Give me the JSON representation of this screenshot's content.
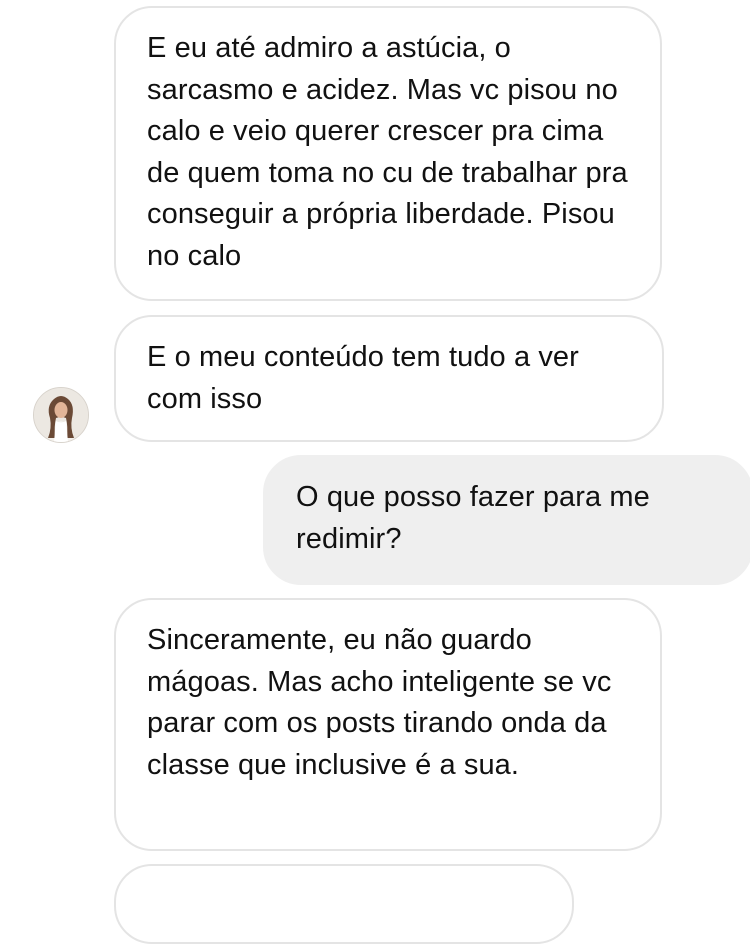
{
  "thread": {
    "messages": [
      {
        "sender": "other",
        "text": "E eu até admiro a astúcia, o sarcasmo e acidez. Mas vc pisou no calo e veio querer crescer pra cima de quem toma no cu de trabalhar pra conseguir a própria liberdade. Pisou no calo"
      },
      {
        "sender": "other",
        "text": "E o meu conteúdo tem tudo a ver com isso"
      },
      {
        "sender": "me",
        "text": "O que posso fazer para me redimir?"
      },
      {
        "sender": "other",
        "text": "Sinceramente, eu não guardo mágoas. Mas acho inteligente se vc parar com os posts tirando onda da classe que inclusive é a sua."
      },
      {
        "sender": "other",
        "text": ""
      }
    ]
  },
  "colors": {
    "received_bubble_bg": "#ffffff",
    "received_bubble_border": "#e4e4e4",
    "sent_bubble_bg": "#efefef",
    "text": "#111111"
  },
  "icons": {
    "avatar": "contact-avatar-photo"
  }
}
